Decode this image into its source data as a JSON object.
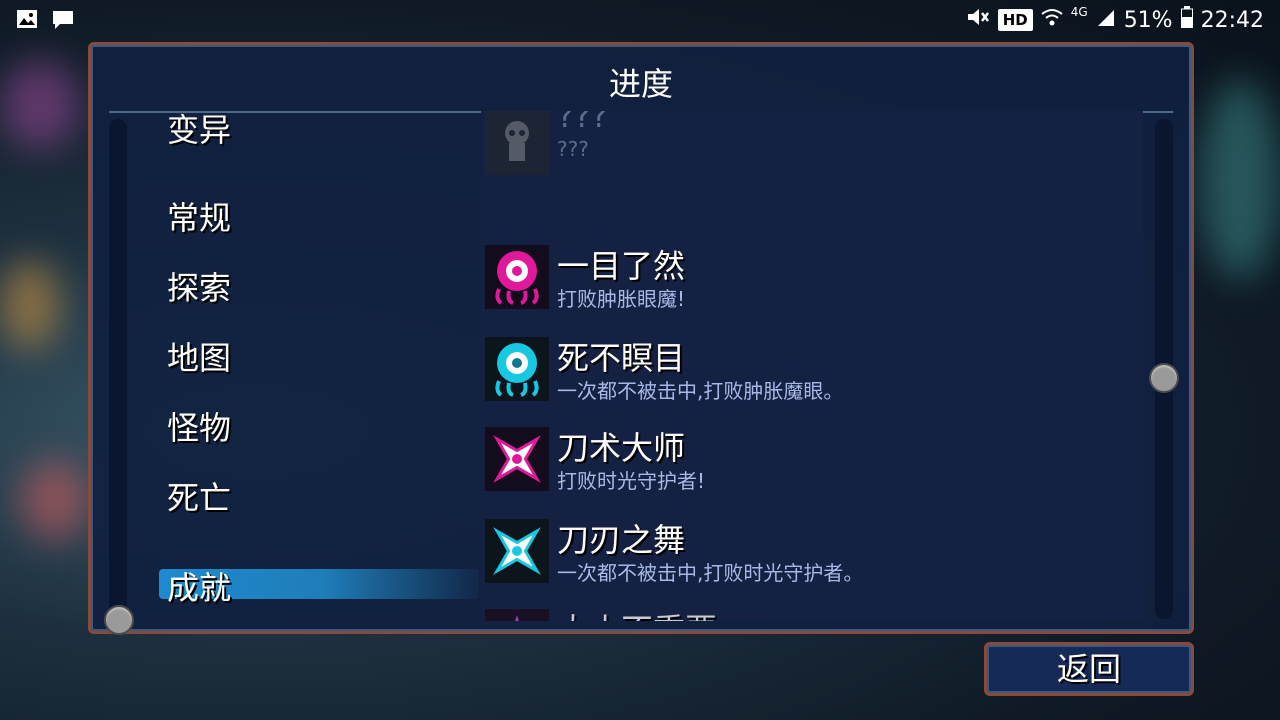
{
  "status_bar": {
    "hd": "HD",
    "network": "4G",
    "battery": "51%",
    "time": "22:42"
  },
  "panel": {
    "title": "进度"
  },
  "categories": [
    {
      "label": "变异"
    },
    {
      "label": "常规"
    },
    {
      "label": "探索"
    },
    {
      "label": "地图"
    },
    {
      "label": "怪物"
    },
    {
      "label": "死亡"
    },
    {
      "label": "成就"
    }
  ],
  "selected_category": "成就",
  "achievements": [
    {
      "title": "???",
      "desc": "???",
      "state": "locked",
      "icon": "locked-skull-icon"
    },
    {
      "title": "一目了然",
      "desc": "打败肿胀眼魔!",
      "state": "unlocked",
      "icon": "pink-eye-monster-icon",
      "color": "#e0189a"
    },
    {
      "title": "死不瞑目",
      "desc": "一次都不被击中,打败肿胀魔眼。",
      "state": "unlocked",
      "icon": "cyan-eye-monster-icon",
      "color": "#18c8e0"
    },
    {
      "title": "刀术大师",
      "desc": "打败时光守护者!",
      "state": "unlocked",
      "icon": "pink-shuriken-icon",
      "color": "#e0189a"
    },
    {
      "title": "刀刃之舞",
      "desc": "一次都不被击中,打败时光守护者。",
      "state": "unlocked",
      "icon": "cyan-shuriken-icon",
      "color": "#18c8e0"
    },
    {
      "title": "大小不重要",
      "desc": "",
      "state": "fading",
      "icon": "purple-flame-icon",
      "color": "#b04ad0"
    }
  ],
  "buttons": {
    "back": "返回"
  }
}
